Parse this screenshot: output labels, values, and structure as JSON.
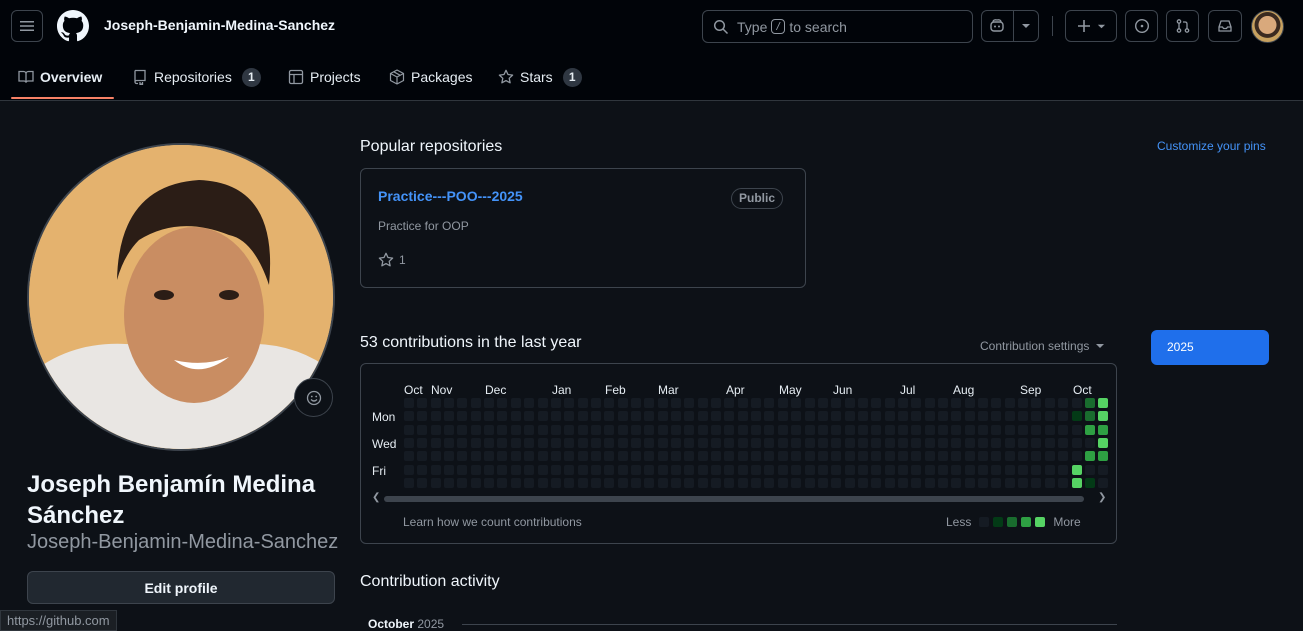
{
  "header": {
    "username": "Joseph-Benjamin-Medina-Sanchez",
    "search_prefix": "Type",
    "search_key": "/",
    "search_suffix": "to search"
  },
  "tabs": [
    {
      "label": "Overview",
      "icon": "book-icon"
    },
    {
      "label": "Repositories",
      "icon": "repo-icon",
      "count": "1"
    },
    {
      "label": "Projects",
      "icon": "table-icon"
    },
    {
      "label": "Packages",
      "icon": "package-icon"
    },
    {
      "label": "Stars",
      "icon": "star-icon",
      "count": "1"
    }
  ],
  "profile": {
    "full_name": "Joseph Benjamín Medina Sánchez",
    "login": "Joseph-Benjamin-Medina-Sanchez",
    "edit_label": "Edit profile"
  },
  "status_bar_url": "https://github.com",
  "popular": {
    "heading": "Popular repositories",
    "customize_label": "Customize your pins",
    "repos": [
      {
        "name": "Practice---POO---2025",
        "visibility": "Public",
        "description": "Practice for OOP",
        "stars": "1"
      }
    ]
  },
  "contributions": {
    "heading": "53 contributions in the last year",
    "settings_label": "Contribution settings",
    "year_button": "2025",
    "months": [
      "Oct",
      "Nov",
      "Dec",
      "Jan",
      "Feb",
      "Mar",
      "Apr",
      "May",
      "Jun",
      "Jul",
      "Aug",
      "Sep",
      "Oct"
    ],
    "days": [
      "Mon",
      "Wed",
      "Fri"
    ],
    "learn_label": "Learn how we count contributions",
    "legend_less": "Less",
    "legend_more": "More",
    "levels": [
      "#151b23",
      "#033a16",
      "#196c2e",
      "#2ea043",
      "#56d364"
    ]
  },
  "activity": {
    "heading": "Contribution activity",
    "month": "October",
    "year": "2025"
  }
}
